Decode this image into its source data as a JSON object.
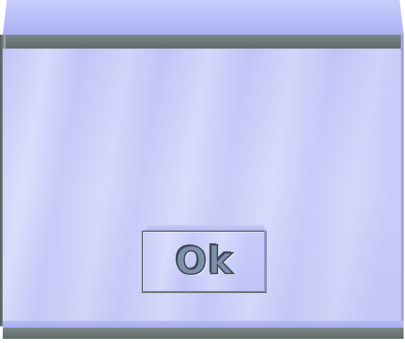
{
  "dialog": {
    "ok_button_label": "Ok"
  },
  "colors": {
    "panel": "#c4c9f8",
    "bevel": "#6b7776",
    "button_border": "#646f70",
    "label": "#7e8fa8"
  }
}
